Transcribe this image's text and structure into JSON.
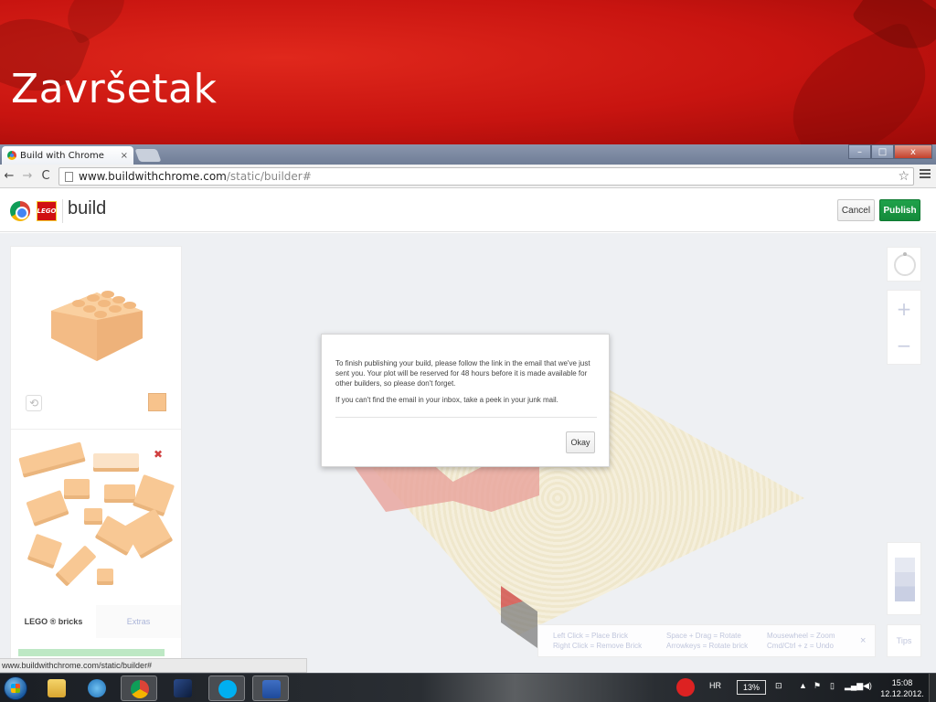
{
  "slide": {
    "title": "Završetak"
  },
  "browser": {
    "tab_title": "Build with Chrome",
    "tab_close": "×",
    "url_host": "www.buildwithchrome.com",
    "url_path": "/static/builder#",
    "status_url": "www.buildwithchrome.com/static/builder#",
    "window_controls": {
      "minimize": "–",
      "maximize": "□",
      "close": "x"
    }
  },
  "app": {
    "logo_text": "build",
    "lego_text": "LEGO",
    "cancel_label": "Cancel",
    "publish_label": "Publish",
    "accent_color": "#1fa24a"
  },
  "panel": {
    "tabs": [
      {
        "label": "LEGO ® bricks"
      },
      {
        "label": "Extras"
      }
    ],
    "selected_color": "#f7c38c"
  },
  "dialog": {
    "paragraph_1": "To finish publishing your build, please follow the link in the email that we've just sent you. Your plot will be reserved for 48 hours before it is made available for other builders, so please don't forget.",
    "paragraph_2": "If you can't find the email in your inbox, take a peek in your junk mail.",
    "okay_label": "Okay"
  },
  "help": {
    "col1_line1": "Left Click = Place Brick",
    "col1_line2": "Right Click = Remove Brick",
    "col2_line1": "Space + Drag = Rotate",
    "col2_line2": "Arrowkeys = Rotate brick",
    "col3_line1": "Mousewheel = Zoom",
    "col3_line2": "Cmd/Ctrl + z = Undo",
    "close": "×",
    "tips_label": "Tips"
  },
  "zoom": {
    "plus": "+",
    "minus": "−"
  },
  "taskbar": {
    "language": "HR",
    "battery": "13%",
    "time": "15:08",
    "date": "12.12.2012."
  }
}
